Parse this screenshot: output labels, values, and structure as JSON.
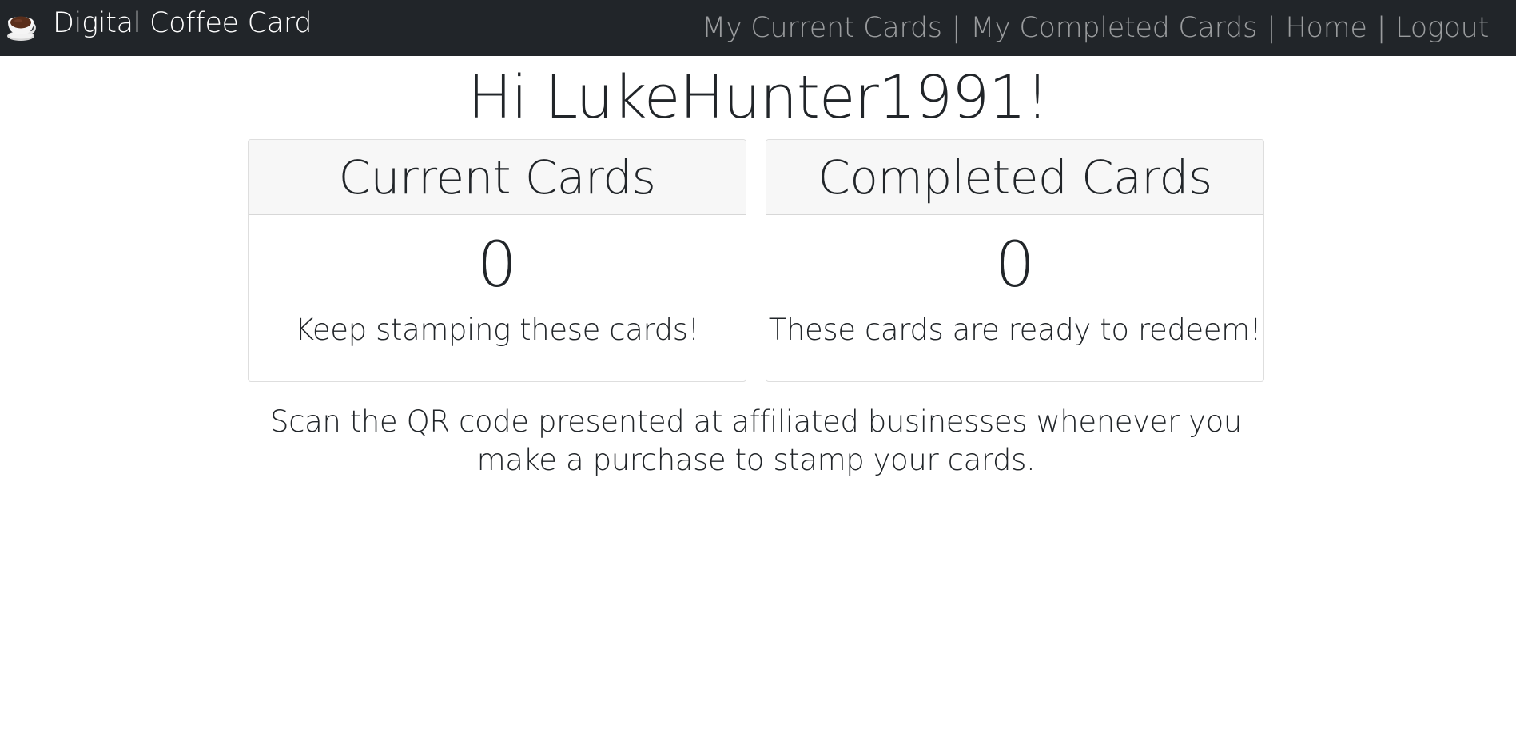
{
  "navbar": {
    "brand_label": "Digital Coffee Card",
    "brand_icon": "coffee-cup-icon",
    "links": [
      {
        "label": "My Current Cards"
      },
      {
        "label": "My Completed Cards"
      },
      {
        "label": "Home"
      },
      {
        "label": "Logout"
      }
    ],
    "separator": "|"
  },
  "greeting": "Hi LukeHunter1991!",
  "cards": {
    "current": {
      "title": "Current Cards",
      "count": "0",
      "text": "Keep stamping these cards!"
    },
    "completed": {
      "title": "Completed Cards",
      "count": "0",
      "text": "These cards are ready to redeem!"
    }
  },
  "instructions": "Scan the QR code presented at affiliated businesses whenever you make a purchase to stamp your cards.",
  "colors": {
    "navbar_bg": "#212529",
    "card_header_bg": "#f7f7f7",
    "coffee": "#5a2e1a"
  }
}
